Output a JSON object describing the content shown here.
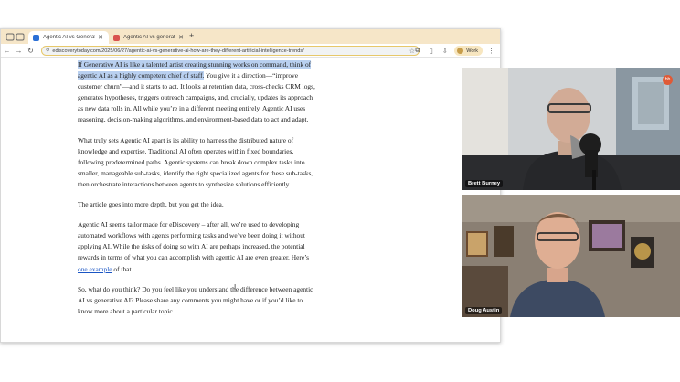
{
  "browser": {
    "tabs": [
      {
        "title": "Agentic AI vs Generative AI: H...",
        "active": true,
        "favicon_color": "#2a6fd6"
      },
      {
        "title": "Agentic AI vs generative AI: T...",
        "active": false,
        "favicon_color": "#d9534f"
      }
    ],
    "new_tab": "+",
    "url": "ediscoverytoday.com/2025/06/27/agentic-ai-vs-generative-ai-how-are-they-different-artificial-intelligence-trends/",
    "profile_label": "Work",
    "accent_color": "#f6e6c8"
  },
  "article": {
    "p1_highlight": "If Generative AI is like a talented artist creating stunning works on command, think of agentic AI as a highly competent chief of staff.",
    "p1_rest": " You give it a direction—“improve customer churn”—and it starts to act. It looks at retention data, cross-checks CRM logs, generates hypotheses, triggers outreach campaigns, and, crucially, updates its approach as new data rolls in. All while you’re in a different meeting entirely. Agentic AI uses reasoning, decision-making algorithms, and environment-based data to act and adapt.",
    "p2": "What truly sets Agentic AI apart is its ability to harness the distributed nature of knowledge and expertise. Traditional AI often operates within fixed boundaries, following predetermined paths. Agentic systems can break down complex tasks into smaller, manageable sub-tasks, identify the right specialized agents for these sub-tasks, then orchestrate interactions between agents to synthesize solutions efficiently.",
    "p3": "The article goes into more depth, but you get the idea.",
    "p4_text": "Agentic AI seems tailor made for eDiscovery – after all, we’re used to developing automated workflows with agents performing tasks and we’ve been doing it without applying AI. While the risks of doing so with AI are perhaps increased, the potential rewards in terms of what you can accomplish with agentic AI are even greater. Here’s ",
    "p4_link": "one example",
    "p4_end": " of that.",
    "p5": "So, what do you think? Do you feel like you understand the difference between agentic AI vs generative AI? Please share any comments you might have or if you’d like to know more about a particular topic."
  },
  "participants": [
    {
      "name": "Brett Burney",
      "badge": "bb"
    },
    {
      "name": "Doug Austin"
    }
  ]
}
